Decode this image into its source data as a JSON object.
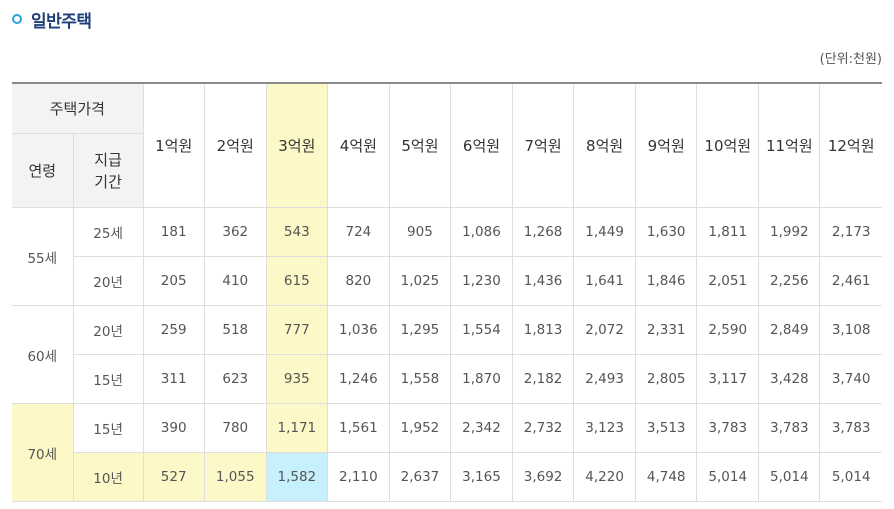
{
  "section": {
    "title": "일반주택"
  },
  "unit_label": "(단위:천원)",
  "table": {
    "corner_label": "주택가격",
    "age_header": "연령",
    "term_header": [
      "지급",
      "기간"
    ],
    "price_headers": [
      "1억원",
      "2억원",
      "3억원",
      "4억원",
      "5억원",
      "6억원",
      "7억원",
      "8억원",
      "9억원",
      "10억원",
      "11억원",
      "12억원"
    ],
    "highlight_color": "#fcf8c8",
    "cell_highlight_color": "#c6f0fb",
    "groups": [
      {
        "age": "55세",
        "rows": [
          {
            "term": "25세",
            "values": [
              "181",
              "362",
              "543",
              "724",
              "905",
              "1,086",
              "1,268",
              "1,449",
              "1,630",
              "1,811",
              "1,992",
              "2,173"
            ]
          },
          {
            "term": "20년",
            "values": [
              "205",
              "410",
              "615",
              "820",
              "1,025",
              "1,230",
              "1,436",
              "1,641",
              "1,846",
              "2,051",
              "2,256",
              "2,461"
            ]
          }
        ]
      },
      {
        "age": "60세",
        "rows": [
          {
            "term": "20년",
            "values": [
              "259",
              "518",
              "777",
              "1,036",
              "1,295",
              "1,554",
              "1,813",
              "2,072",
              "2,331",
              "2,590",
              "2,849",
              "3,108"
            ]
          },
          {
            "term": "15년",
            "values": [
              "311",
              "623",
              "935",
              "1,246",
              "1,558",
              "1,870",
              "2,182",
              "2,493",
              "2,805",
              "3,117",
              "3,428",
              "3,740"
            ]
          }
        ]
      },
      {
        "age": "70세",
        "rows": [
          {
            "term": "15년",
            "values": [
              "390",
              "780",
              "1,171",
              "1,561",
              "1,952",
              "2,342",
              "2,732",
              "3,123",
              "3,513",
              "3,783",
              "3,783",
              "3,783"
            ]
          },
          {
            "term": "10년",
            "values": [
              "527",
              "1,055",
              "1,582",
              "2,110",
              "2,637",
              "3,165",
              "3,692",
              "4,220",
              "4,748",
              "5,014",
              "5,014",
              "5,014"
            ]
          }
        ]
      }
    ]
  }
}
